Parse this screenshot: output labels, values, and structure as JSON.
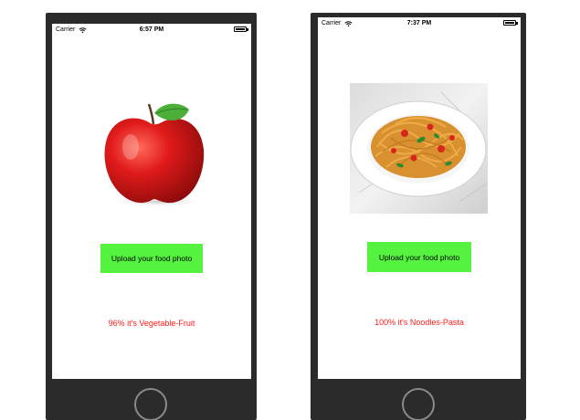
{
  "left_phone": {
    "status": {
      "carrier": "Carrier",
      "time": "6:57 PM"
    },
    "food_image": "apple",
    "upload_label": "Upload your food photo",
    "result_text": "96% it's Vegetable-Fruit"
  },
  "right_phone": {
    "status": {
      "carrier": "Carrier",
      "time": "7:37 PM"
    },
    "food_image": "spaghetti",
    "upload_label": "Upload your food photo",
    "result_text": "100% it's Noodles-Pasta"
  },
  "colors": {
    "button": "#55f33f",
    "result": "#ff1a1a",
    "frame": "#2b2b2b"
  }
}
